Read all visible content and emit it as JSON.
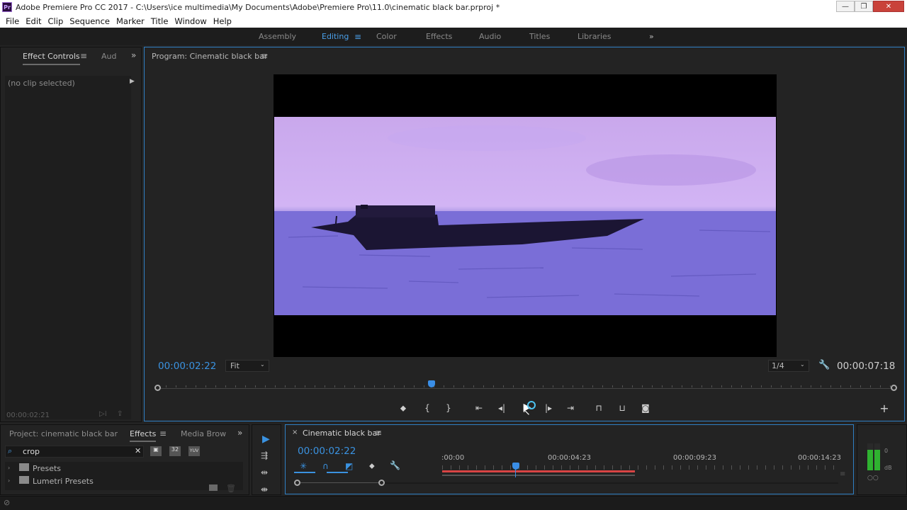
{
  "window": {
    "title": "Adobe Premiere Pro CC 2017 - C:\\Users\\ice multimedia\\My Documents\\Adobe\\Premiere Pro\\11.0\\cinematic black bar.prproj *",
    "logo": "Pr"
  },
  "menu": [
    "File",
    "Edit",
    "Clip",
    "Sequence",
    "Marker",
    "Title",
    "Window",
    "Help"
  ],
  "workspaces": {
    "items": [
      "Assembly",
      "Editing",
      "Effects",
      "Audio",
      "Titles",
      "Libraries"
    ],
    "active": "Editing",
    "color_label": "Color"
  },
  "effect_controls": {
    "tab1": "Effect Controls",
    "tab2": "Aud",
    "no_clip": "(no clip selected)",
    "timecode": "00:00:02:21"
  },
  "program_monitor": {
    "title": "Program: Cinematic black bar",
    "timecode": "00:00:02:22",
    "fit": "Fit",
    "resolution": "1/4",
    "duration": "00:00:07:18"
  },
  "project_panel": {
    "tab1": "Project: cinematic black bar",
    "tab2": "Effects",
    "tab3": "Media Brow",
    "search_value": "crop",
    "badges": [
      "32",
      "YUV"
    ],
    "tree": [
      "Presets",
      "Lumetri Presets"
    ]
  },
  "timeline": {
    "title": "Cinematic black bar",
    "timecode": "00:00:02:22",
    "ruler": [
      ":00:00",
      "00:00:04:23",
      "00:00:09:23",
      "00:00:14:23"
    ]
  },
  "audio_meter": {
    "top_label": "0",
    "db_label": "dB"
  },
  "colors": {
    "accent": "#2f7fc4",
    "timecode": "#3a92e0",
    "playhead": "#3a8ee6",
    "workarea": "#d84444"
  }
}
